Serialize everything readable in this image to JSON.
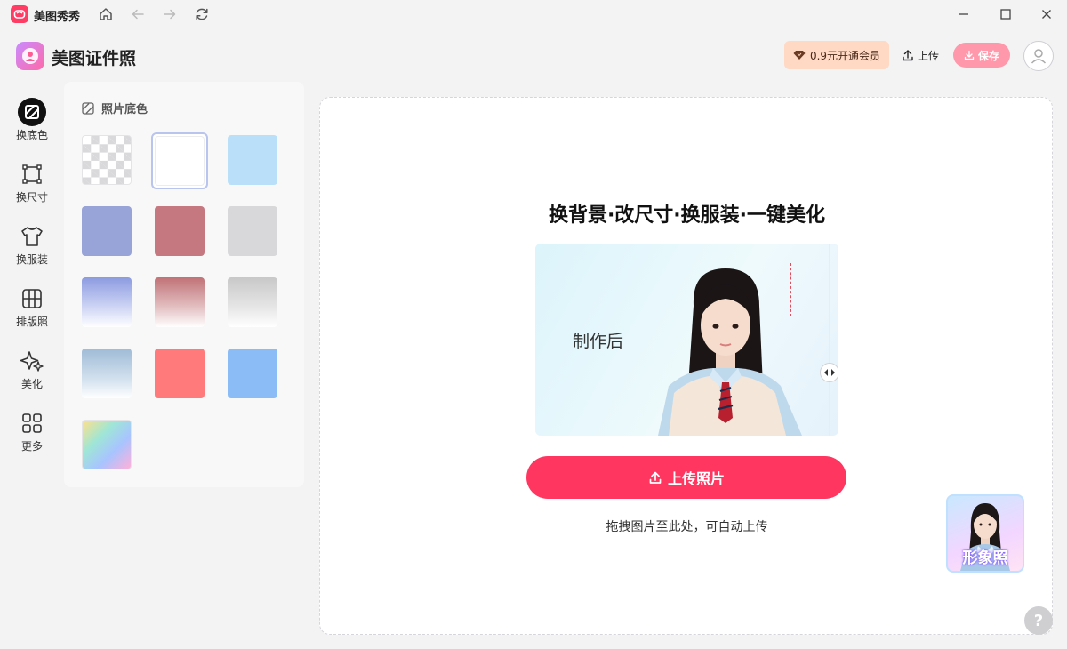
{
  "titlebar": {
    "app_name": "美图秀秀",
    "icons": [
      "home-icon",
      "back-icon",
      "forward-icon",
      "refresh-icon",
      "minimize-icon",
      "maximize-icon",
      "close-icon"
    ]
  },
  "header": {
    "brand_name": "美图证件照",
    "vip_label": "0.9元开通会员",
    "upload_label": "上传",
    "save_label": "保存"
  },
  "sidebar": {
    "items": [
      {
        "label": "换底色",
        "icon": "background-color-icon",
        "active": true
      },
      {
        "label": "换尺寸",
        "icon": "crop-size-icon",
        "active": false
      },
      {
        "label": "换服装",
        "icon": "shirt-icon",
        "active": false
      },
      {
        "label": "排版照",
        "icon": "grid-layout-icon",
        "active": false
      },
      {
        "label": "美化",
        "icon": "sparkle-icon",
        "active": false
      },
      {
        "label": "更多",
        "icon": "apps-icon",
        "active": false
      }
    ]
  },
  "color_panel": {
    "title": "照片底色",
    "swatches": [
      {
        "name": "transparent",
        "fill": "checker"
      },
      {
        "name": "white",
        "fill": "#ffffff",
        "selected": true
      },
      {
        "name": "light-blue",
        "fill": "#b9e0f8"
      },
      {
        "name": "blue-purple",
        "fill": "#98a4d7"
      },
      {
        "name": "rose-red",
        "fill": "#c57880"
      },
      {
        "name": "light-gray",
        "fill": "#d8d7da"
      },
      {
        "name": "blue-gradient",
        "fill": "#8c9be0"
      },
      {
        "name": "red-gradient",
        "fill": "#c07276"
      },
      {
        "name": "gray-gradient",
        "fill": "#c8c8c8"
      },
      {
        "name": "steel-blue-gradient",
        "fill": "#9fbbd6"
      },
      {
        "name": "coral-red",
        "fill": "#ff7b7b"
      },
      {
        "name": "sky-blue",
        "fill": "#8cbcf5"
      },
      {
        "name": "rainbow-gradient",
        "fill": "rainbow"
      }
    ]
  },
  "main": {
    "headline": "换背景·改尺寸·换服装·一键美化",
    "preview_label": "制作后",
    "upload_button": "上传照片",
    "drag_hint": "拖拽图片至此处，可自动上传"
  },
  "floating_card": {
    "label": "形象照"
  },
  "help_label": "?"
}
